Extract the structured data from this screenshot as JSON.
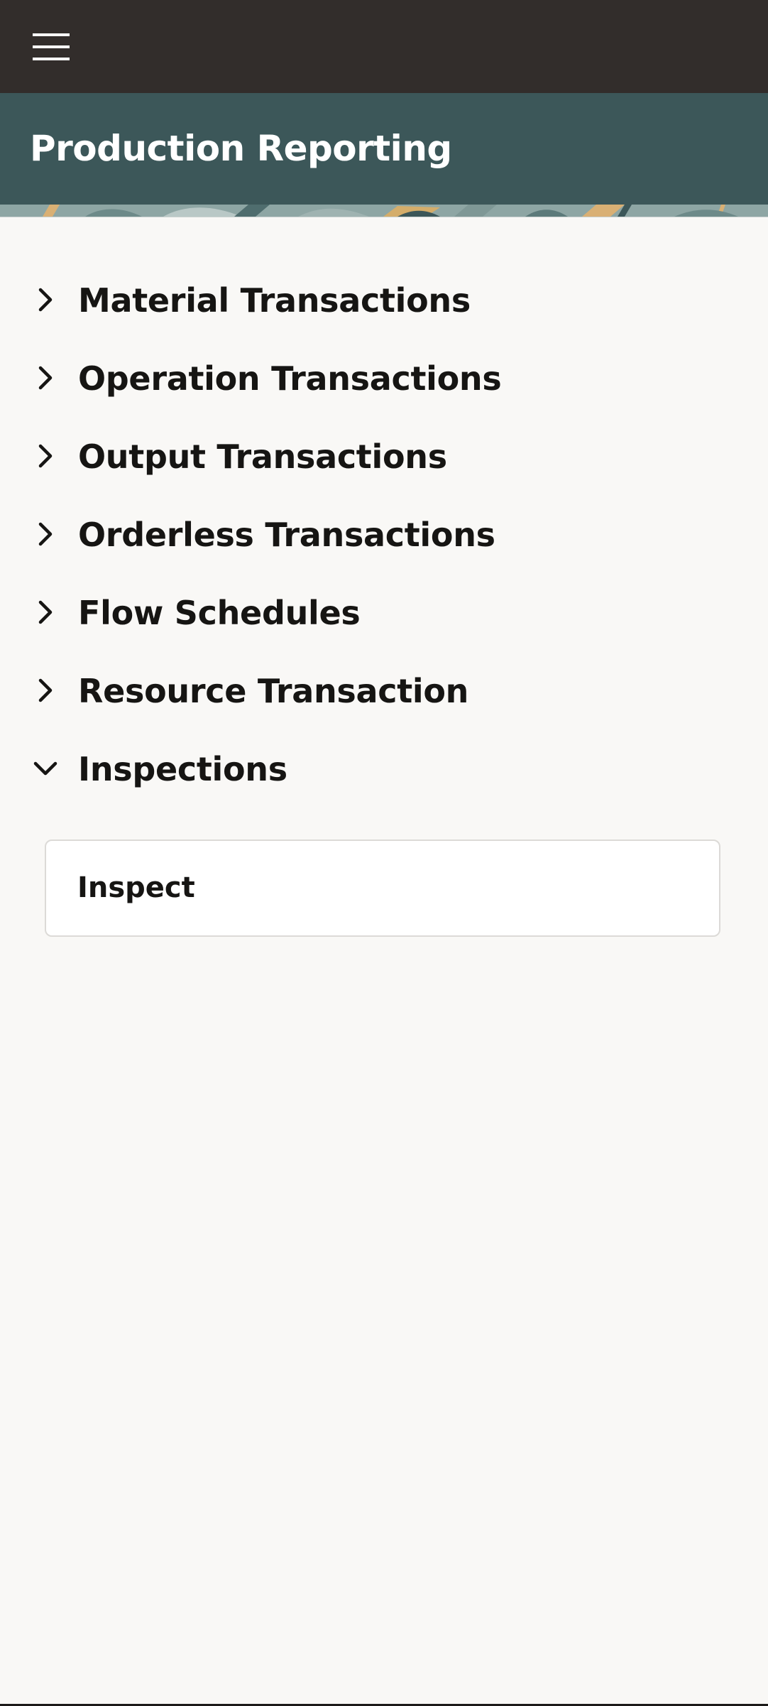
{
  "header": {
    "title": "Production Reporting"
  },
  "icons": {
    "menu": "hamburger-menu-icon",
    "collapsed": "chevron-right-icon",
    "expanded": "chevron-down-icon"
  },
  "nav": {
    "items": [
      {
        "label": "Material Transactions",
        "expanded": false
      },
      {
        "label": "Operation Transactions",
        "expanded": false
      },
      {
        "label": "Output Transactions",
        "expanded": false
      },
      {
        "label": "Orderless Transactions",
        "expanded": false
      },
      {
        "label": "Flow Schedules",
        "expanded": false
      },
      {
        "label": "Resource Transaction",
        "expanded": false
      },
      {
        "label": "Inspections",
        "expanded": true
      }
    ],
    "inspections_children": [
      {
        "label": "Inspect"
      }
    ]
  },
  "colors": {
    "top_bar": "#322d2b",
    "header_bg": "#3c5759",
    "page_bg": "#f9f8f6",
    "text": "#161513",
    "card_border": "#dcdad7"
  }
}
